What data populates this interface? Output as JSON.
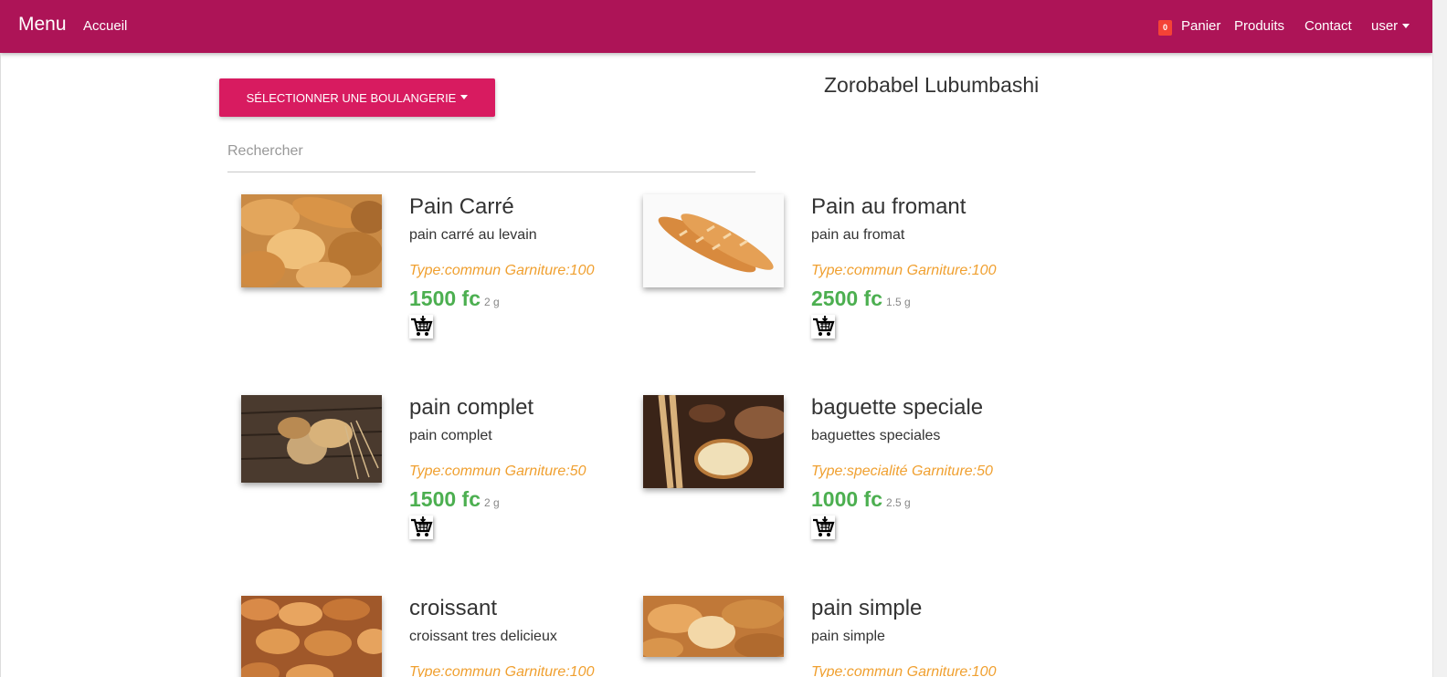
{
  "navbar": {
    "brand": "Menu",
    "home": "Accueil",
    "cart_count": "0",
    "cart": "Panier",
    "products": "Produits",
    "contact": "Contact",
    "user": "user",
    "bg_color": "#ad1457"
  },
  "main": {
    "select_button": "Sélectionner une boulangerie",
    "bakery_name": "Zorobabel Lubumbashi",
    "search_placeholder": "Rechercher"
  },
  "products": [
    {
      "name": "Pain Carré",
      "description": "pain carré au levain",
      "type_line": "Type:commun Garniture:100",
      "price": "1500 fc",
      "weight": "2 g",
      "image": "bread-assortment"
    },
    {
      "name": "Pain au fromant",
      "description": "pain au fromat",
      "type_line": "Type:commun Garniture:100",
      "price": "2500 fc",
      "weight": "1.5 g",
      "image": "baguettes-white"
    },
    {
      "name": "pain complet",
      "description": "pain complet",
      "type_line": "Type:commun Garniture:50",
      "price": "1500 fc",
      "weight": "2 g",
      "image": "bread-on-wood"
    },
    {
      "name": "baguette speciale",
      "description": "baguettes speciales",
      "type_line": "Type:specialité Garniture:50",
      "price": "1000 fc",
      "weight": "2.5 g",
      "image": "sliced-bread-dark"
    },
    {
      "name": "croissant",
      "description": "croissant tres delicieux",
      "type_line": "Type:commun Garniture:100",
      "price": "",
      "weight": "",
      "image": "croissants-pile"
    },
    {
      "name": "pain simple",
      "description": "pain simple",
      "type_line": "Type:commun Garniture:100",
      "price": "",
      "weight": "",
      "image": "bread-rolls"
    }
  ],
  "colors": {
    "primary_button": "#d81b60",
    "price": "#4caf50",
    "type_text": "#f0a030"
  }
}
